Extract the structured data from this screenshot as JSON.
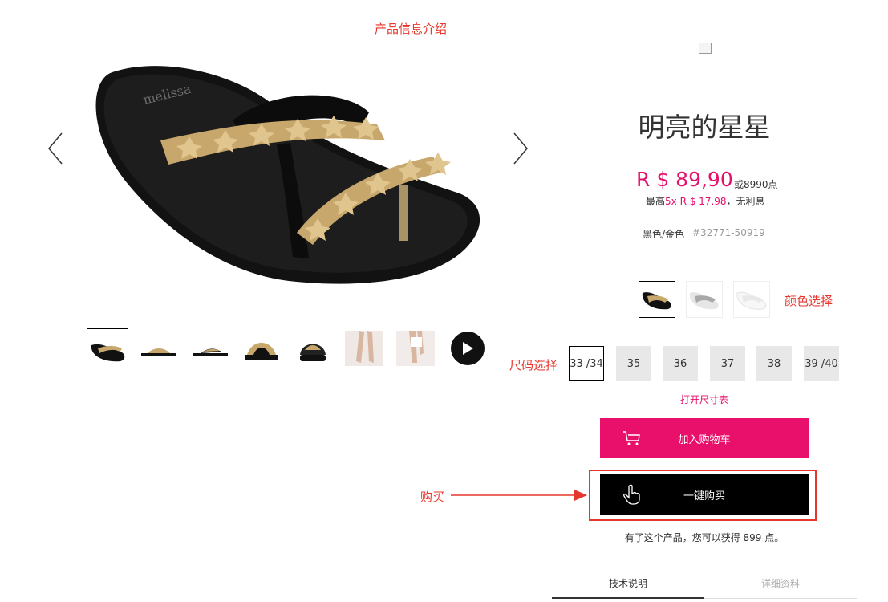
{
  "annotations": {
    "product_info": "产品信息介绍",
    "color_select": "颜色选择",
    "size_select": "尺码选择",
    "buy": "购买"
  },
  "product": {
    "title": "明亮的星星",
    "price": "R $ 89,90",
    "points_alt": "或8990点",
    "installment_prefix": "最高",
    "installment_highlight": "5x R $ 17.98",
    "installment_suffix": "，无利息",
    "color_name": "黑色/金色",
    "sku": "#32771-50919"
  },
  "gallery": {
    "thumbnails": [
      "black-sandal-top",
      "black-sandal-side",
      "black-sandal-side-2",
      "black-sandal-front",
      "black-sandal-back",
      "model-legs-1",
      "model-legs-2"
    ],
    "video": "play-icon"
  },
  "colors": [
    "black-gold",
    "silver",
    "white"
  ],
  "sizes": [
    "33 /34",
    "35",
    "36",
    "37",
    "38",
    "39 /40"
  ],
  "selected_size": "33 /34",
  "size_chart_link": "打开尺寸表",
  "buttons": {
    "add_to_cart": "加入购物车",
    "buy_now": "一键购买"
  },
  "reward_text": "有了这个产品，您可以获得 899 点。",
  "tabs": [
    "技术说明",
    "详细资料"
  ],
  "colors_theme": {
    "accent": "#e8106a",
    "annotation": "#e6372c"
  }
}
